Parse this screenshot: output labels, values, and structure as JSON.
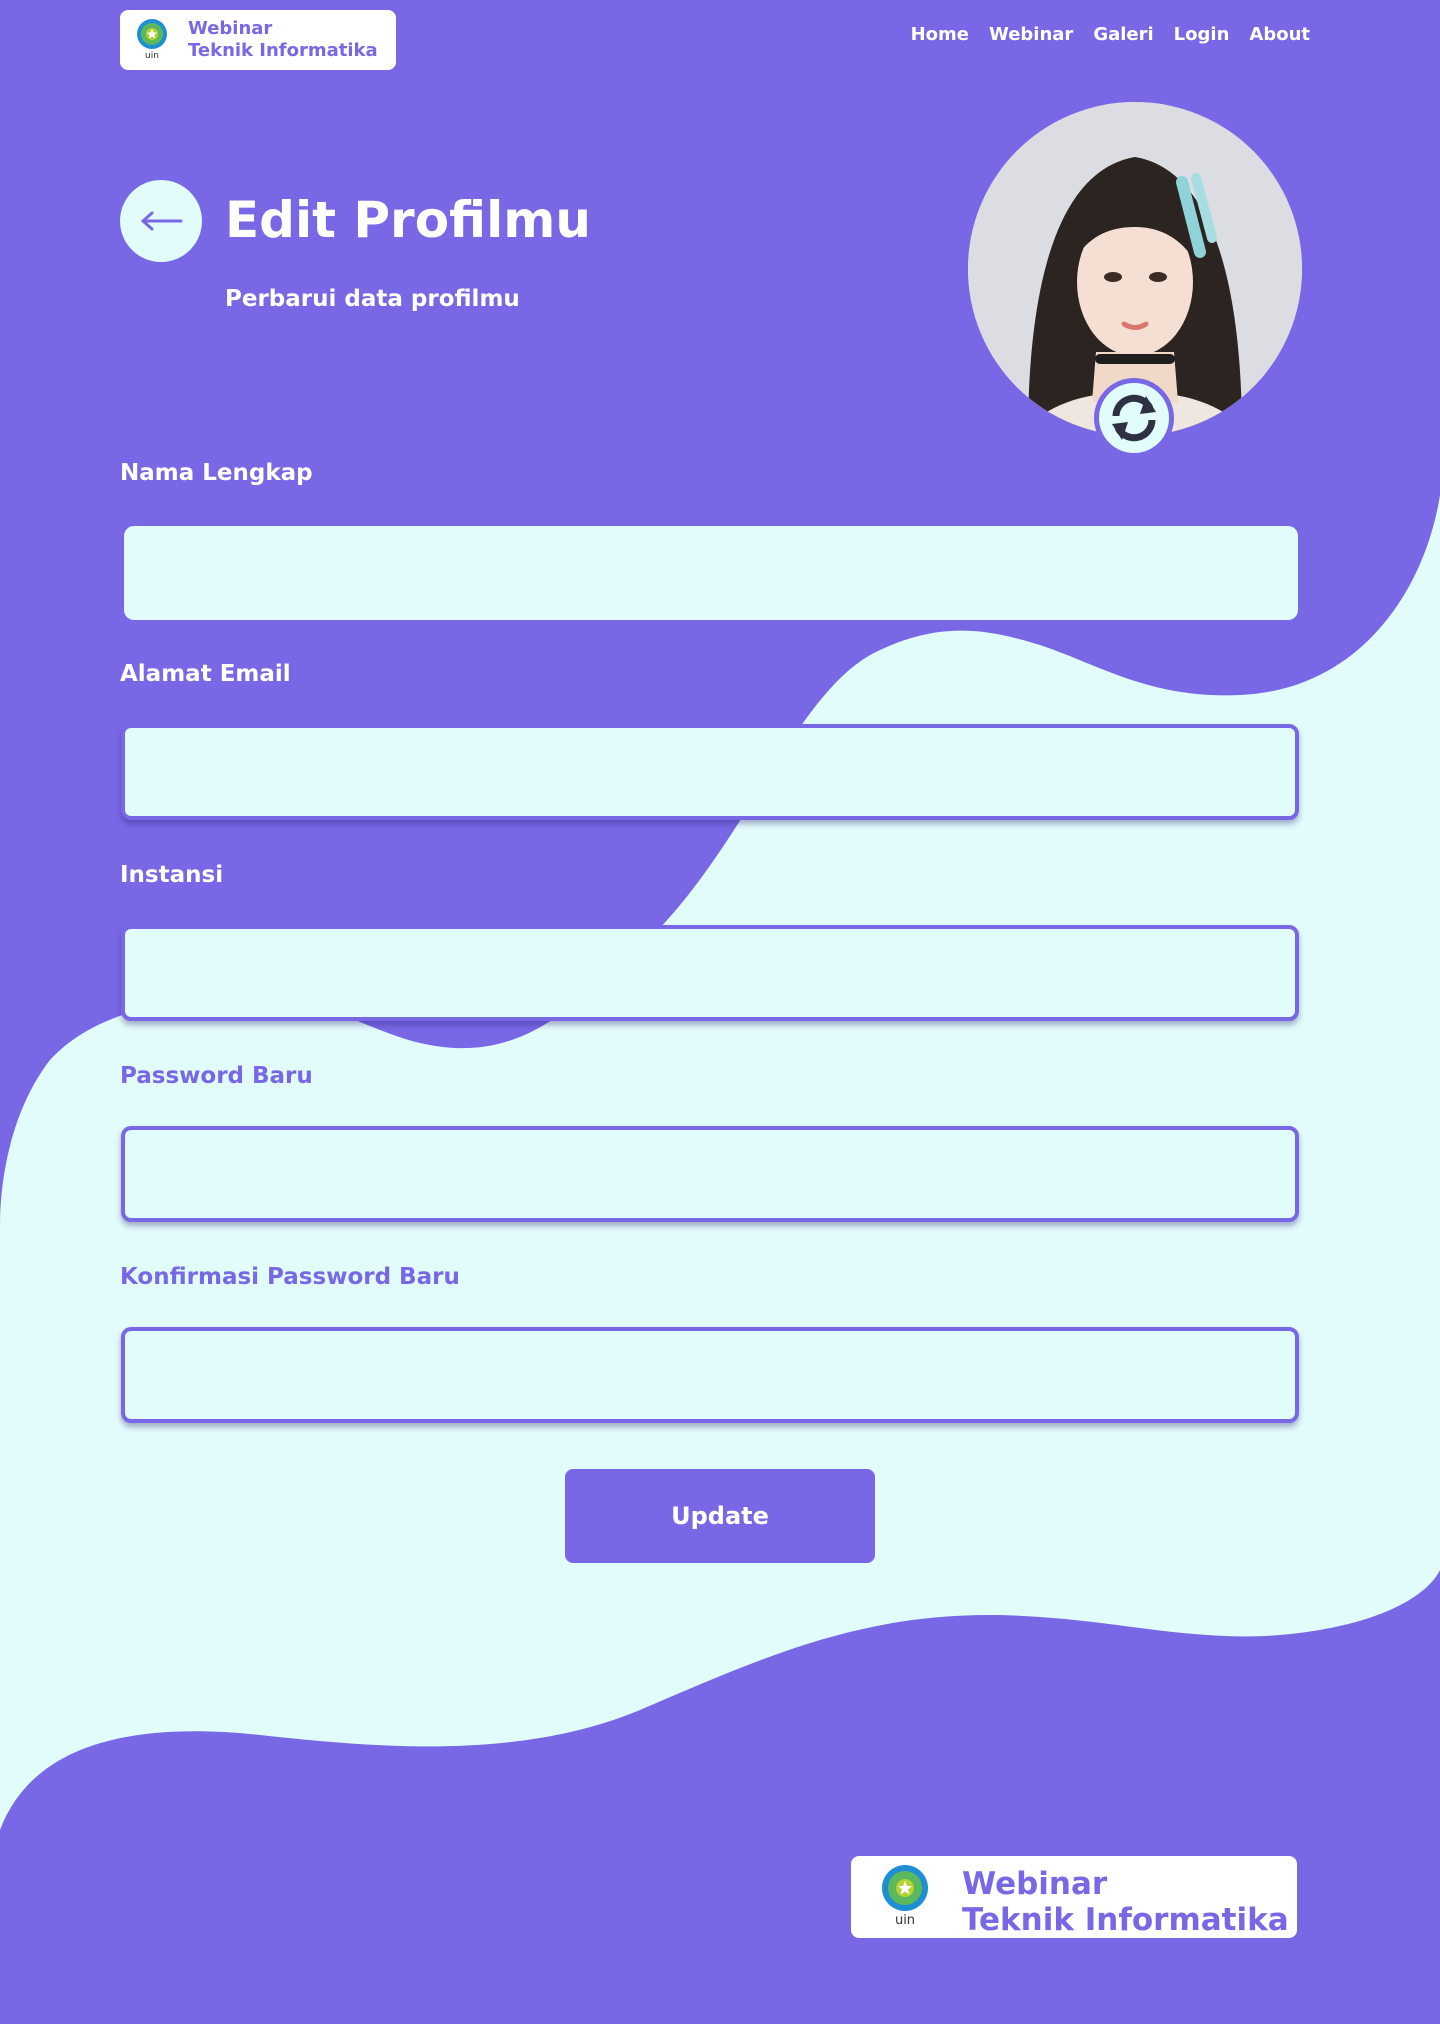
{
  "colors": {
    "primary": "#7868E6",
    "light": "#E2FBFB",
    "white": "#FFFFFF"
  },
  "header": {
    "brand_line1": "Webinar",
    "brand_line2": "Teknik Informatika",
    "logo_icon": "uin-logo-icon",
    "nav": [
      {
        "label": "Home"
      },
      {
        "label": "Webinar"
      },
      {
        "label": "Galeri"
      },
      {
        "label": "Login"
      },
      {
        "label": "About"
      }
    ]
  },
  "hero": {
    "back_icon": "arrow-left-icon",
    "title": "Edit Profilmu",
    "subtitle": "Perbarui data profilmu"
  },
  "profile": {
    "avatar": "profile-photo",
    "change_icon": "refresh-icon"
  },
  "form": {
    "fields": [
      {
        "label": "Nama Lengkap",
        "value": "",
        "type": "text"
      },
      {
        "label": "Alamat Email",
        "value": "",
        "type": "email"
      },
      {
        "label": "Instansi",
        "value": "",
        "type": "text"
      },
      {
        "label": "Password Baru",
        "value": "",
        "type": "password"
      },
      {
        "label": "Konfirmasi Password Baru",
        "value": "",
        "type": "password"
      }
    ],
    "submit_label": "Update"
  },
  "footer": {
    "brand_line1": "Webinar",
    "brand_line2": "Teknik Informatika",
    "logo_icon": "uin-logo-icon"
  }
}
